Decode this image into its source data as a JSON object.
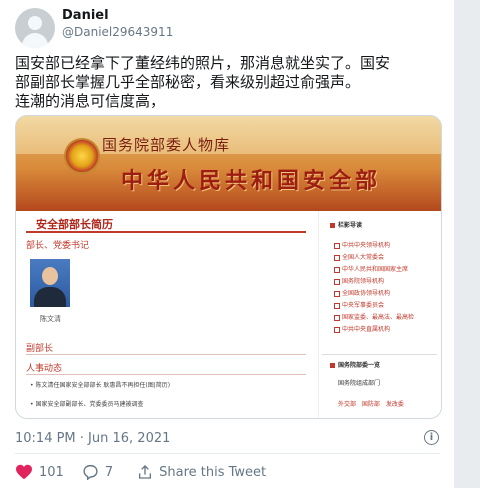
{
  "author": {
    "name": "Daniel",
    "handle": "@Daniel29643911"
  },
  "tweet_text": [
    "国安部已经拿下了董经纬的照片，那消息就坐实了。国安",
    "部副部长掌握几乎全部秘密，看来级别超过俞强声。",
    "连潮的消息可信度高，"
  ],
  "card": {
    "banner_small": "国务院部委人物库",
    "banner_big": "中华人民共和国安全部",
    "section_title": "安全部部长简历",
    "sub_title": "部长、党委书记",
    "photo_name": "陈文清",
    "vice_title": "副部长",
    "personnel_title": "人事动态",
    "news": [
      "• 陈文清任国家安全部部长  耿惠昌不再担任(图|简历)",
      "• 国家安全部副部长、党委委员马建被调查"
    ],
    "nav_title": "栏影导读",
    "nav_items": [
      "中共中央领导机构",
      "全国人大常委会",
      "中华人民共和国国家主席",
      "国务院领导机构",
      "全国政协领导机构",
      "中央军事委员会",
      "国家监委、最高法、最高检",
      "中共中央直属机构"
    ],
    "state_title": "国务院部委一览",
    "state_sub": "国务院组成部门",
    "state_links": "外交部  国防部  发改委"
  },
  "timestamp": "10:14 PM · Jun 16, 2021",
  "actions": {
    "likes": "101",
    "replies": "7",
    "share": "Share this Tweet"
  },
  "colors": {
    "like_red": "#e0245e",
    "muted": "#657786"
  }
}
